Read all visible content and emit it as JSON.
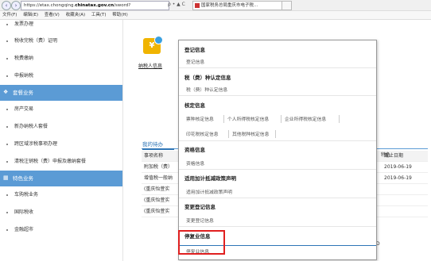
{
  "browser": {
    "url_prefix": "https://etax.chongqing.",
    "url_domain": "chinatax.gov.cn",
    "url_suffix": "/sword?",
    "url_controls": "ρ • ▲ C",
    "tab_title": "国家税务总局重庆市电子税...",
    "tab_close": "×",
    "menu": [
      "文件(F)",
      "编辑(E)",
      "查看(V)",
      "收藏夹(A)",
      "工具(T)",
      "帮助(H)"
    ]
  },
  "sidebar": {
    "items_top": [
      "发票办理",
      "税收完税（费）证明",
      "税费缴纳",
      "申报纳税"
    ],
    "section1": "套餐业务",
    "items_mid": [
      "房产交易",
      "新办纳税人套餐",
      "跨区域涉税事项办理",
      "清税注销税（费）申报及缴纳套餐"
    ],
    "section2": "特色业务",
    "items_bottom": [
      "车购税业务",
      "国际税收",
      "金融超市"
    ]
  },
  "main": {
    "card_label": "纳税人信息",
    "card_icon_text": "¥",
    "todo_title": "我的待办",
    "table_header": {
      "col1": "事项名称",
      "col3": "截止日期"
    },
    "rows": [
      {
        "col1": "附加税（费）",
        "col3": "2019-06-19"
      },
      {
        "col1": "增值税一般纳",
        "col3": "2019-06-19"
      },
      {
        "col1": "(重庆怡萱实",
        "col3": ""
      },
      {
        "col1": "(重庆怡萱实",
        "col3": ""
      },
      {
        "col1": "(重庆怡萱实",
        "col3": ""
      }
    ],
    "right_fragments": {
      "a": "特色",
      "b": "D"
    }
  },
  "popup": {
    "sec1": {
      "title": "登记信息",
      "items": [
        "登记信息"
      ]
    },
    "sec2": {
      "title": "税（费）种认定信息",
      "items": [
        "税（费）种认定信息"
      ]
    },
    "sec3": {
      "title": "核定信息",
      "items": [
        "票种核定信息",
        "个人所得税核定信息",
        "企业所得税核定信息",
        "印花税核定信息",
        "其他税种核定信息"
      ]
    },
    "sec4": {
      "title": "资格信息",
      "items": [
        "资格信息"
      ]
    },
    "sec5": {
      "title": "适用加计抵减政策声明",
      "items": [
        "适用加计抵减政策声明"
      ]
    },
    "sec6": {
      "title": "变更登记信息",
      "items": [
        "变更登记信息"
      ]
    },
    "sec7": {
      "title": "停复业信息",
      "items": [
        "停复业信息"
      ]
    }
  },
  "colors": {
    "accent": "#5b9bd5",
    "highlight": "#e02020"
  }
}
